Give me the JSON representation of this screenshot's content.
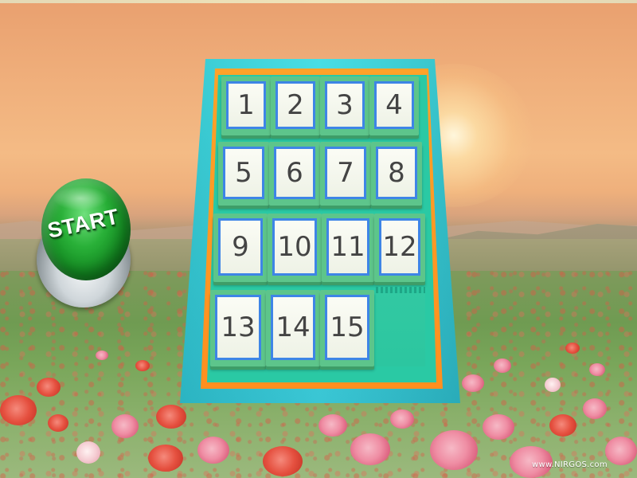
{
  "game": {
    "start_button_label": "START",
    "watermark": "www.NIRGOS.com",
    "tiles": [
      "1",
      "2",
      "3",
      "4",
      "5",
      "6",
      "7",
      "8",
      "9",
      "10",
      "11",
      "12",
      "13",
      "14",
      "15"
    ]
  },
  "colors": {
    "start_button": "#1f9a2c",
    "board_frame": "#3bd4de",
    "board_border": "#ff9a24",
    "board_inner": "#2ac9a4",
    "tile_border": "#3e85e6",
    "tile_face": "#f6f8ee"
  }
}
